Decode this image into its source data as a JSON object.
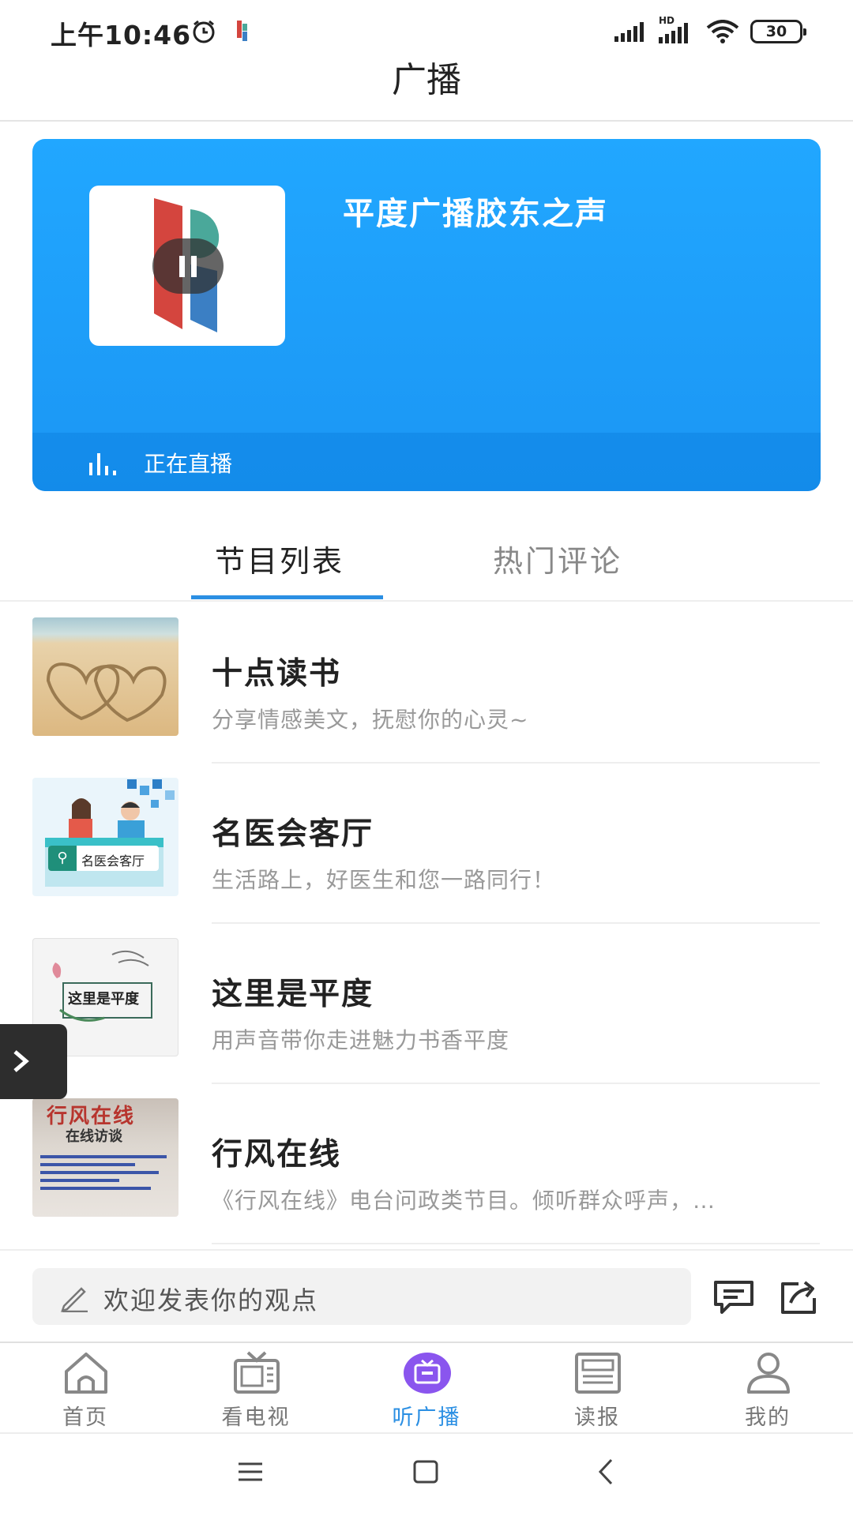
{
  "status_bar": {
    "time": "上午10:46",
    "network": "HD",
    "battery": "30",
    "icons": [
      "alarm-icon",
      "app-icon",
      "signal-icon",
      "hd-signal-icon",
      "wifi-icon",
      "battery-icon"
    ]
  },
  "header": {
    "title": "广播"
  },
  "banner": {
    "station_name": "平度广播胶东之声",
    "live_status": "正在直播",
    "colors": {
      "background": "#1f9ef8",
      "logo_red": "#d4453e",
      "logo_teal": "#4aa89a",
      "logo_blue": "#3b7fc4"
    }
  },
  "tabs": [
    {
      "label": "节目列表",
      "active": true
    },
    {
      "label": "热门评论",
      "active": false
    }
  ],
  "programs": [
    {
      "title": "十点读书",
      "description": "分享情感美文，抚慰你的心灵~"
    },
    {
      "title": "名医会客厅",
      "description": "生活路上，好医生和您一路同行！",
      "thumb_text": "名医会客厅"
    },
    {
      "title": "这里是平度",
      "description": "用声音带你走进魅力书香平度",
      "thumb_text": "这里是平度"
    },
    {
      "title": "行风在线",
      "description": "《行风在线》电台问政类节目。倾听群众呼声，…",
      "thumb_text": "行风在线",
      "thumb_subtext": "在线访谈"
    }
  ],
  "comment": {
    "placeholder": "欢迎发表你的观点"
  },
  "bottom_nav": [
    {
      "label": "首页",
      "icon": "home-icon",
      "active": false
    },
    {
      "label": "看电视",
      "icon": "tv-icon",
      "active": false
    },
    {
      "label": "听广播",
      "icon": "radio-icon",
      "active": true
    },
    {
      "label": "读报",
      "icon": "newspaper-icon",
      "active": false
    },
    {
      "label": "我的",
      "icon": "user-icon",
      "active": false
    }
  ],
  "accent_color": "#2b8fe3"
}
